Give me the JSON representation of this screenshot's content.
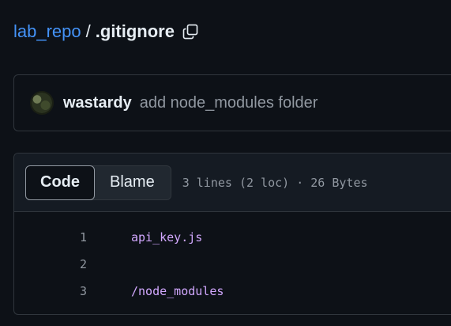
{
  "breadcrumb": {
    "repo": "lab_repo",
    "separator": "/",
    "file": ".gitignore"
  },
  "icons": {
    "copy": "copy-icon"
  },
  "commit": {
    "author": "wastardy",
    "message": "add node_modules folder"
  },
  "file_header": {
    "code_label": "Code",
    "blame_label": "Blame",
    "meta": "3 lines (2 loc) · 26 Bytes"
  },
  "code_lines": [
    {
      "number": "1",
      "text": "api_key.js"
    },
    {
      "number": "2",
      "text": ""
    },
    {
      "number": "3",
      "text": "/node_modules"
    }
  ],
  "colors": {
    "background": "#0d1117",
    "link": "#4493f8",
    "code_text": "#d2a8ff",
    "muted": "#9198a1",
    "border": "#30363d"
  }
}
